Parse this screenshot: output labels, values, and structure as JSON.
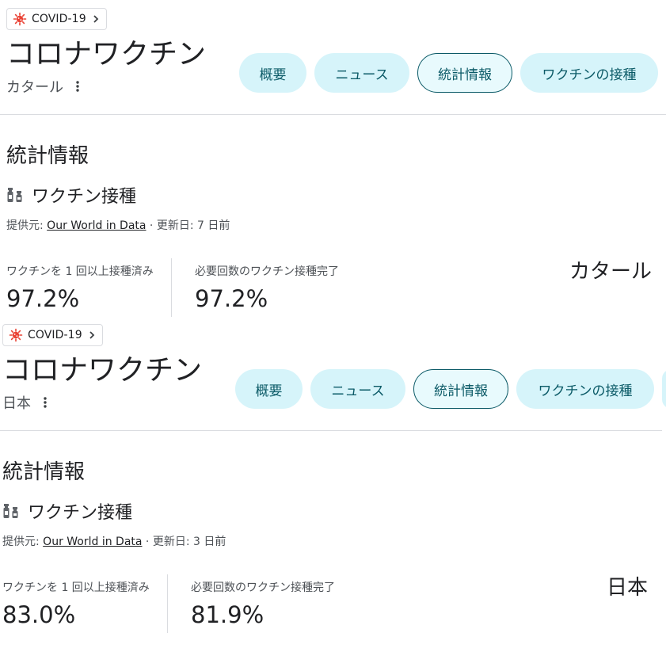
{
  "cards": [
    {
      "chip_label": "COVID-19",
      "title": "コロナワクチン",
      "location": "カタール",
      "tabs": [
        "概要",
        "ニュース",
        "統計情報",
        "ワクチンの接種"
      ],
      "section_heading": "統計情報",
      "vaccination_title": "ワクチン接種",
      "source_prefix": "提供元: ",
      "source_link": "Our World in Data",
      "updated": " · 更新日: 7 日前",
      "stat1_label": "ワクチンを 1 回以上接種済み",
      "stat1_value": "97.2%",
      "stat2_label": "必要回数のワクチン接種完了",
      "stat2_value": "97.2%",
      "country": "カタール"
    },
    {
      "chip_label": "COVID-19",
      "title": "コロナワクチン",
      "location": "日本",
      "tabs": [
        "概要",
        "ニュース",
        "統計情報",
        "ワクチンの接種"
      ],
      "section_heading": "統計情報",
      "vaccination_title": "ワクチン接種",
      "source_prefix": "提供元: ",
      "source_link": "Our World in Data",
      "updated": " · 更新日: 3 日前",
      "stat1_label": "ワクチンを 1 回以上接種済み",
      "stat1_value": "83.0%",
      "stat2_label": "必要回数のワクチン接種完了",
      "stat2_value": "81.9%",
      "country": "日本"
    }
  ],
  "selected_tab": "統計情報",
  "colors": {
    "virus_red": "#ea4335",
    "tab_bg": "#d6f4fa",
    "tab_text": "#0b5a67"
  }
}
